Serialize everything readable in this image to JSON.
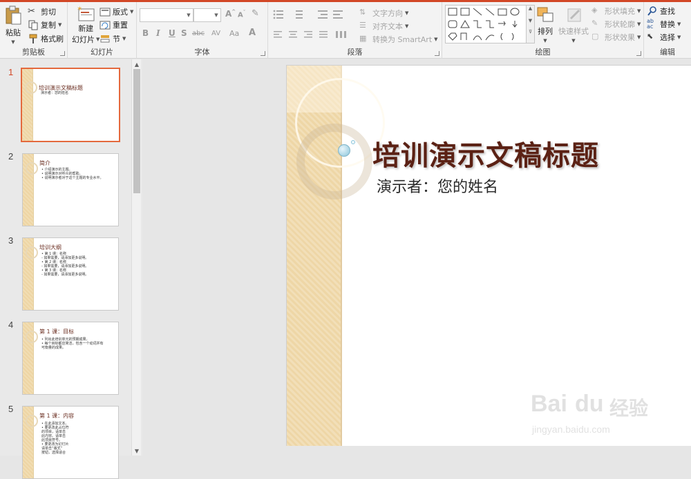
{
  "ribbon": {
    "clipboard": {
      "group_label": "剪贴板",
      "paste": "粘贴",
      "cut": "剪切",
      "copy": "复制",
      "format_painter": "格式刷"
    },
    "slides": {
      "group_label": "幻灯片",
      "new_slide_line1": "新建",
      "new_slide_line2": "幻灯片",
      "layout": "版式",
      "reset": "重置",
      "section": "节"
    },
    "font": {
      "group_label": "字体",
      "font_name": "",
      "font_size": "",
      "bold": "B",
      "italic": "I",
      "underline": "U",
      "shadow": "S",
      "strike": "abc",
      "spacing": "AV",
      "case": "Aa",
      "color": "A"
    },
    "paragraph": {
      "group_label": "段落",
      "text_direction": "文字方向",
      "align_text": "对齐文本",
      "smartart": "转换为 SmartArt"
    },
    "drawing": {
      "group_label": "绘图",
      "arrange": "排列",
      "quick_styles": "快速样式",
      "shape_fill": "形状填充",
      "shape_outline": "形状轮廓",
      "shape_effects": "形状效果"
    },
    "editing": {
      "group_label": "编辑",
      "find": "查找",
      "replace": "替换",
      "select": "选择"
    }
  },
  "thumbnails": [
    {
      "num": "1",
      "title": "培训演示文稿标题",
      "lines": [
        "演示者：您的姓名"
      ]
    },
    {
      "num": "2",
      "title": "简介",
      "lines": [
        "• 介绍演示的主题。",
        "• 说明演示对听众的帮助。",
        "• 说明演示者对于这个主题的专业水平。"
      ]
    },
    {
      "num": "3",
      "title": "培训大纲",
      "lines": [
        "• 第 1 课：名称",
        "   - 如果需要，请添加更多说明。",
        "• 第 2 课：名称",
        "   - 如果需要，请添加更多说明。",
        "• 第 3 课：名称",
        "   - 如果需要，请添加更多说明。"
      ]
    },
    {
      "num": "4",
      "title": "第 1 课：目标",
      "lines": [
        "• 列出此培训单元的预期成果。",
        "• 每个目标都应简洁，包含一个动词并有",
        "  可衡量的成果。"
      ]
    },
    {
      "num": "5",
      "title": "第 1 课：内容",
      "lines": [
        "• 在此添加文本。",
        "• 要更改此占位符",
        "  的项目，请单击",
        "  此内容。请单击",
        "  此项目符号。",
        "• 要更改为幻灯片",
        "  请单击“版式”",
        "  按钮，选择适合"
      ]
    }
  ],
  "slide": {
    "title": "培训演示文稿标题",
    "subtitle": "演示者：您的姓名"
  },
  "watermark": {
    "brand": "Bai",
    "paw": "du",
    "cn": "经验",
    "url": "jingyan.baidu.com"
  },
  "colors": {
    "accent": "#d24726",
    "title": "#5b2114",
    "band": "#f2dfb8"
  }
}
